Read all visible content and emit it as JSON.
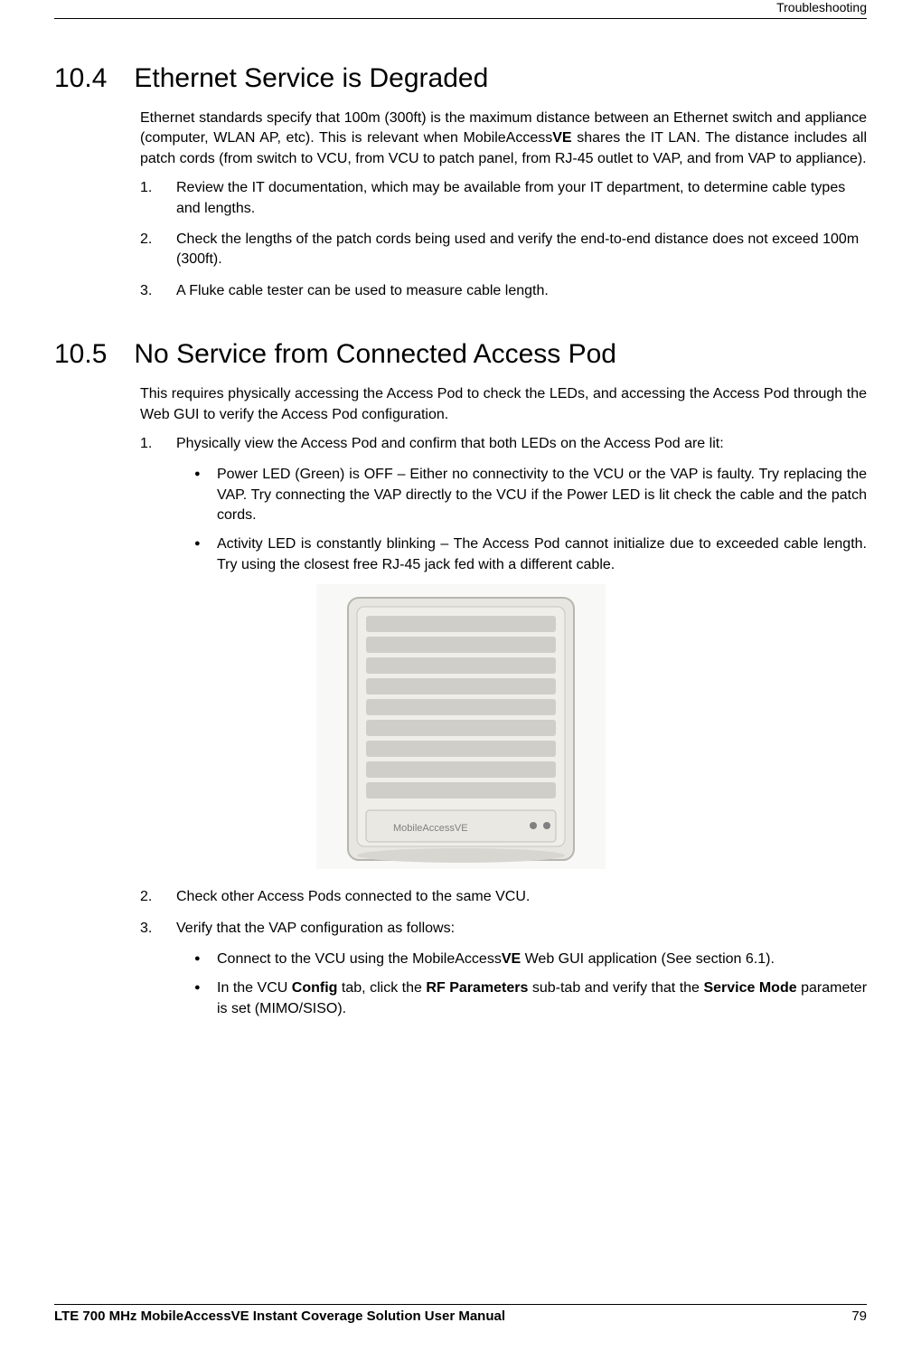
{
  "header": {
    "breadcrumb": "Troubleshooting"
  },
  "section_10_4": {
    "number": "10.4",
    "title": "Ethernet Service is Degraded",
    "intro_p1": "Ethernet standards specify that 100m (300ft) is the maximum distance between an Ethernet switch and appliance (computer, WLAN AP, etc). This is relevant when MobileAccess",
    "intro_bold": "VE",
    "intro_p2": " shares the IT LAN. The distance includes all patch cords (from switch to VCU, from VCU to patch panel, from RJ-45 outlet to VAP, and from VAP to appliance).",
    "steps": [
      "Review the IT documentation, which may be available from your IT department, to determine cable types and lengths.",
      "Check the lengths of the patch cords being used and verify the end-to-end distance does not exceed 100m (300ft).",
      "A Fluke cable tester can be used to measure cable length."
    ]
  },
  "section_10_5": {
    "number": "10.5",
    "title": "No Service from Connected Access Pod",
    "intro": "This requires physically accessing the Access Pod to check the LEDs, and accessing the Access Pod through the Web GUI to verify the Access Pod configuration.",
    "step1": "Physically view the Access Pod and confirm that both LEDs on the Access Pod are lit:",
    "bullets_a": [
      "Power LED (Green) is OFF – Either no connectivity to the VCU or the VAP is faulty. Try replacing the VAP. Try connecting the VAP directly to the VCU if the Power LED is lit check the cable and the patch cords.",
      "Activity LED is constantly blinking – The Access Pod cannot initialize due to exceeded cable length. Try using the closest free RJ-45 jack fed with a different cable."
    ],
    "step2": "Check other Access Pods connected to the same VCU.",
    "step3": "Verify that the VAP configuration as follows:",
    "bullet_b1_pre": "Connect to the VCU using the MobileAccess",
    "bullet_b1_bold": "VE",
    "bullet_b1_post": " Web GUI application (See section 6.1).",
    "bullet_b2_p1": "In the VCU ",
    "bullet_b2_b1": "Config",
    "bullet_b2_p2": " tab, click the ",
    "bullet_b2_b2": "RF Parameters",
    "bullet_b2_p3": " sub-tab and verify that the ",
    "bullet_b2_b3": "Service Mode",
    "bullet_b2_p4": " parameter is set (MIMO/SISO)."
  },
  "footer": {
    "manual_title": "LTE 700 MHz MobileAccessVE Instant Coverage Solution User Manual",
    "page": "79"
  }
}
